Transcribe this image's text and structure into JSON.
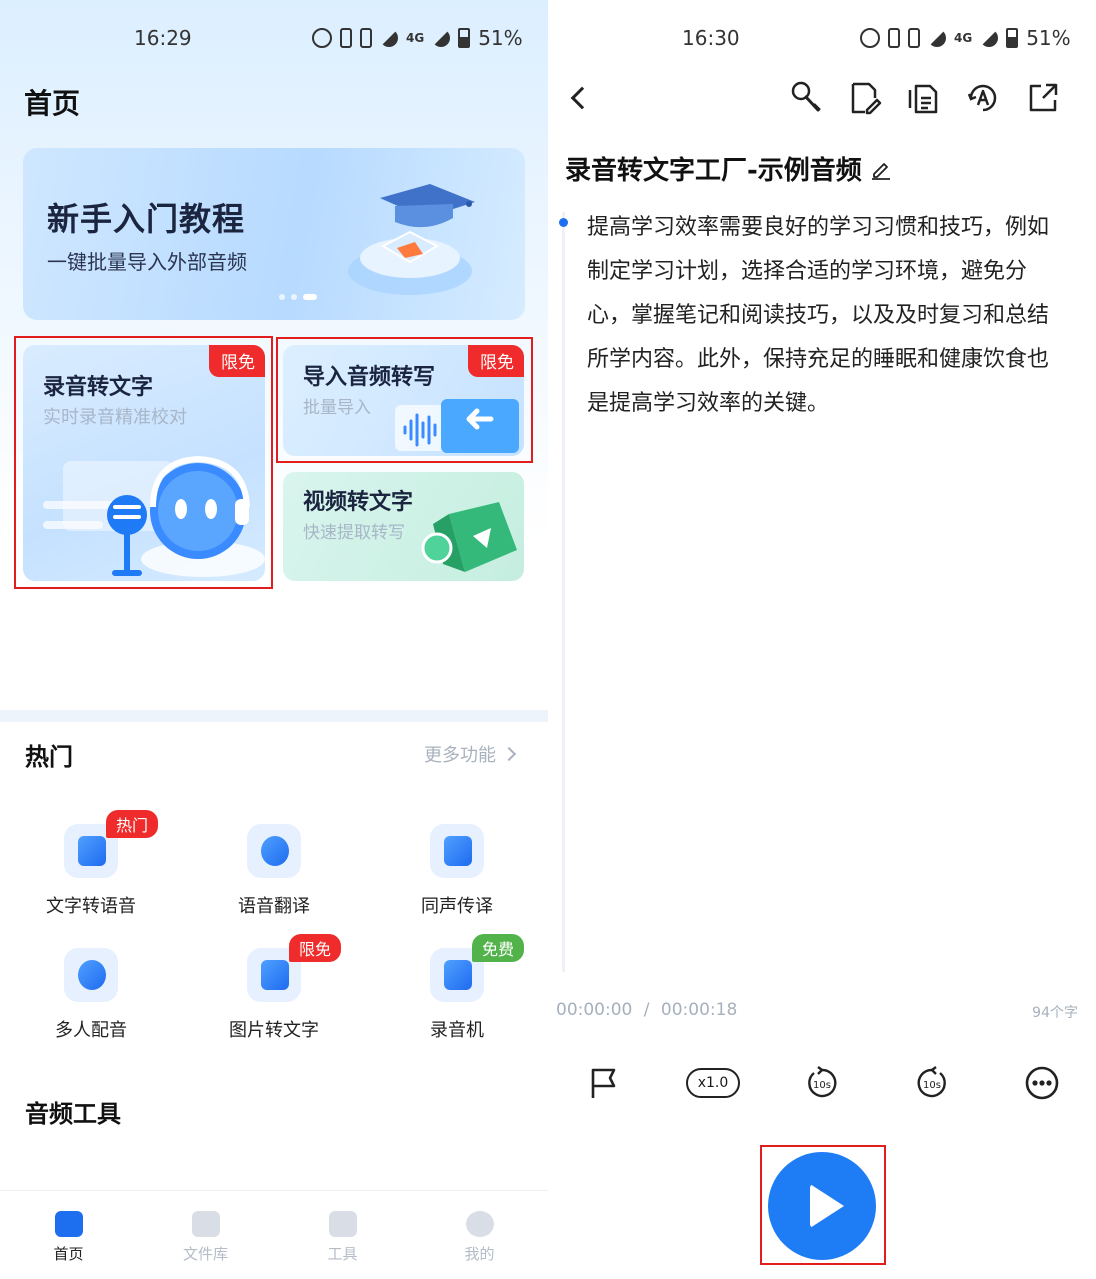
{
  "left": {
    "status": {
      "time": "16:29",
      "battery": "51%",
      "network": "4G"
    },
    "page_title": "首页",
    "banner": {
      "title": "新手入门教程",
      "subtitle": "一键批量导入外部音频"
    },
    "cards": {
      "record": {
        "title": "录音转文字",
        "subtitle": "实时录音精准校对",
        "badge": "限免"
      },
      "import": {
        "title": "导入音频转写",
        "subtitle": "批量导入",
        "badge": "限免"
      },
      "video": {
        "title": "视频转文字",
        "subtitle": "快速提取转写"
      }
    },
    "hot": {
      "title": "热门",
      "more": "更多功能",
      "items": [
        {
          "label": "文字转语音",
          "tag": "热门",
          "icon": "text-to-speech-icon"
        },
        {
          "label": "语音翻译",
          "icon": "voice-translate-icon"
        },
        {
          "label": "同声传译",
          "icon": "simultaneous-interpretation-icon"
        },
        {
          "label": "多人配音",
          "icon": "multi-voice-dubbing-icon"
        },
        {
          "label": "图片转文字",
          "tag": "限免",
          "icon": "image-to-text-icon"
        },
        {
          "label": "录音机",
          "tag": "免费",
          "icon": "recorder-icon"
        }
      ]
    },
    "audio_tools": {
      "title": "音频工具"
    },
    "bottom_nav": [
      {
        "label": "首页",
        "icon": "home-icon",
        "active": true
      },
      {
        "label": "文件库",
        "icon": "files-icon"
      },
      {
        "label": "工具",
        "icon": "tools-icon"
      },
      {
        "label": "我的",
        "icon": "profile-icon"
      }
    ]
  },
  "right": {
    "status": {
      "time": "16:30",
      "battery": "51%",
      "network": "4G"
    },
    "toolbar": [
      "back-icon",
      "microphone-edit-icon",
      "document-edit-icon",
      "copy-document-icon",
      "translate-icon",
      "share-icon"
    ],
    "doc_title": "录音转文字工厂-示例音频",
    "paragraph": "提高学习效率需要良好的学习习惯和技巧，例如制定学习计划，选择合适的学习环境，避免分心，掌握笔记和阅读技巧，以及及时复习和总结所学内容。此外，保持充足的睡眠和健康饮食也是提高学习效率的关键。",
    "time_current": "00:00:00",
    "time_sep": "/",
    "time_total": "00:00:18",
    "word_count": "94个字",
    "speed": "x1.0",
    "rewind_label": "10s",
    "forward_label": "10s"
  },
  "colors": {
    "accent": "#1e7cf5",
    "badge_red": "#ef2b2b",
    "badge_green": "#52b34a",
    "highlight_box": "#e11d1d"
  }
}
